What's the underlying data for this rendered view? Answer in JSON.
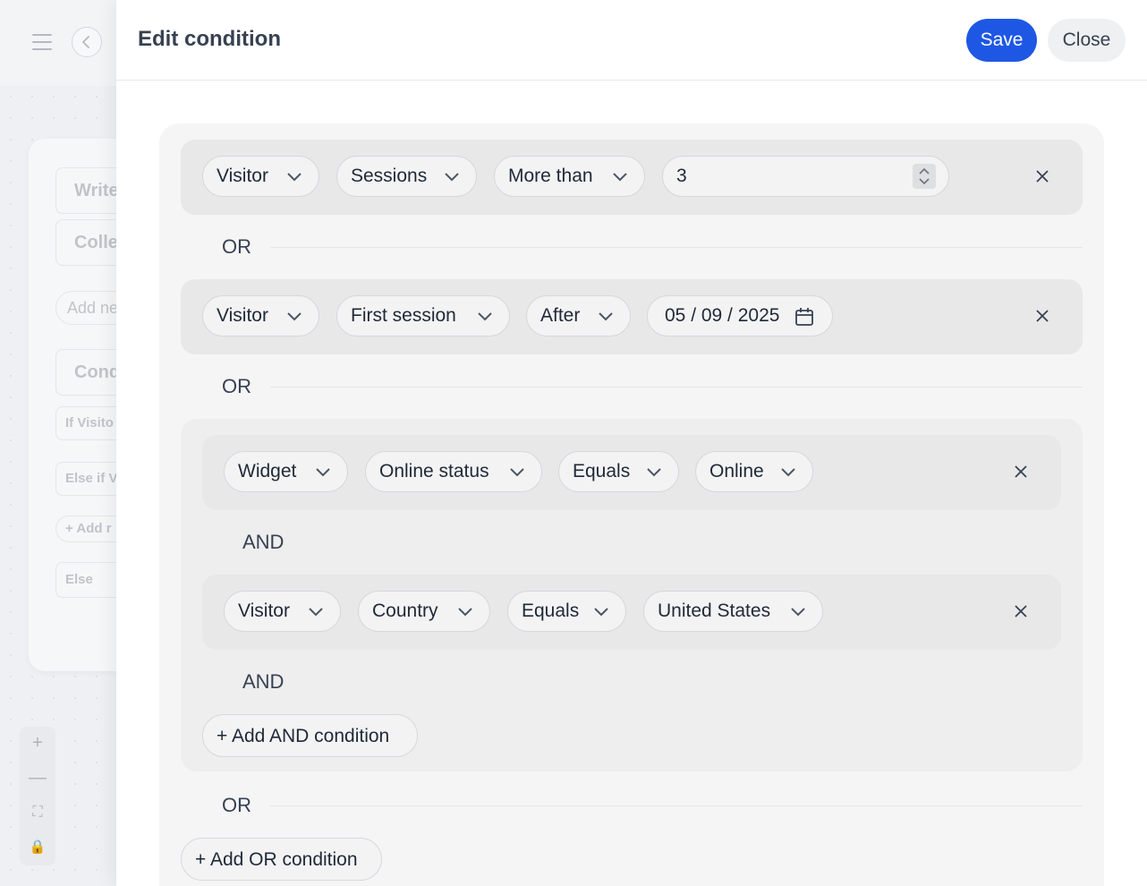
{
  "background": {
    "items": [
      "Write",
      "Colle",
      "Add ne",
      "Cond",
      "If Visito",
      "Else if V",
      "+ Add r",
      "Else"
    ]
  },
  "panel": {
    "title": "Edit condition",
    "save_label": "Save",
    "close_label": "Close"
  },
  "conditions": {
    "row1": {
      "subject": "Visitor",
      "field": "Sessions",
      "operator": "More than",
      "value": "3"
    },
    "or1": "OR",
    "row2": {
      "subject": "Visitor",
      "field": "First session",
      "operator": "After",
      "value": "05 / 09 / 2025"
    },
    "or2": "OR",
    "group": {
      "row1": {
        "subject": "Widget",
        "field": "Online status",
        "operator": "Equals",
        "value": "Online"
      },
      "and1": "AND",
      "row2": {
        "subject": "Visitor",
        "field": "Country",
        "operator": "Equals",
        "value": "United States"
      },
      "and2": "AND",
      "add_and_label": "+ Add AND condition"
    },
    "or3": "OR",
    "add_or_label": "+ Add OR condition"
  },
  "colors": {
    "accent": "#1f57e5"
  }
}
